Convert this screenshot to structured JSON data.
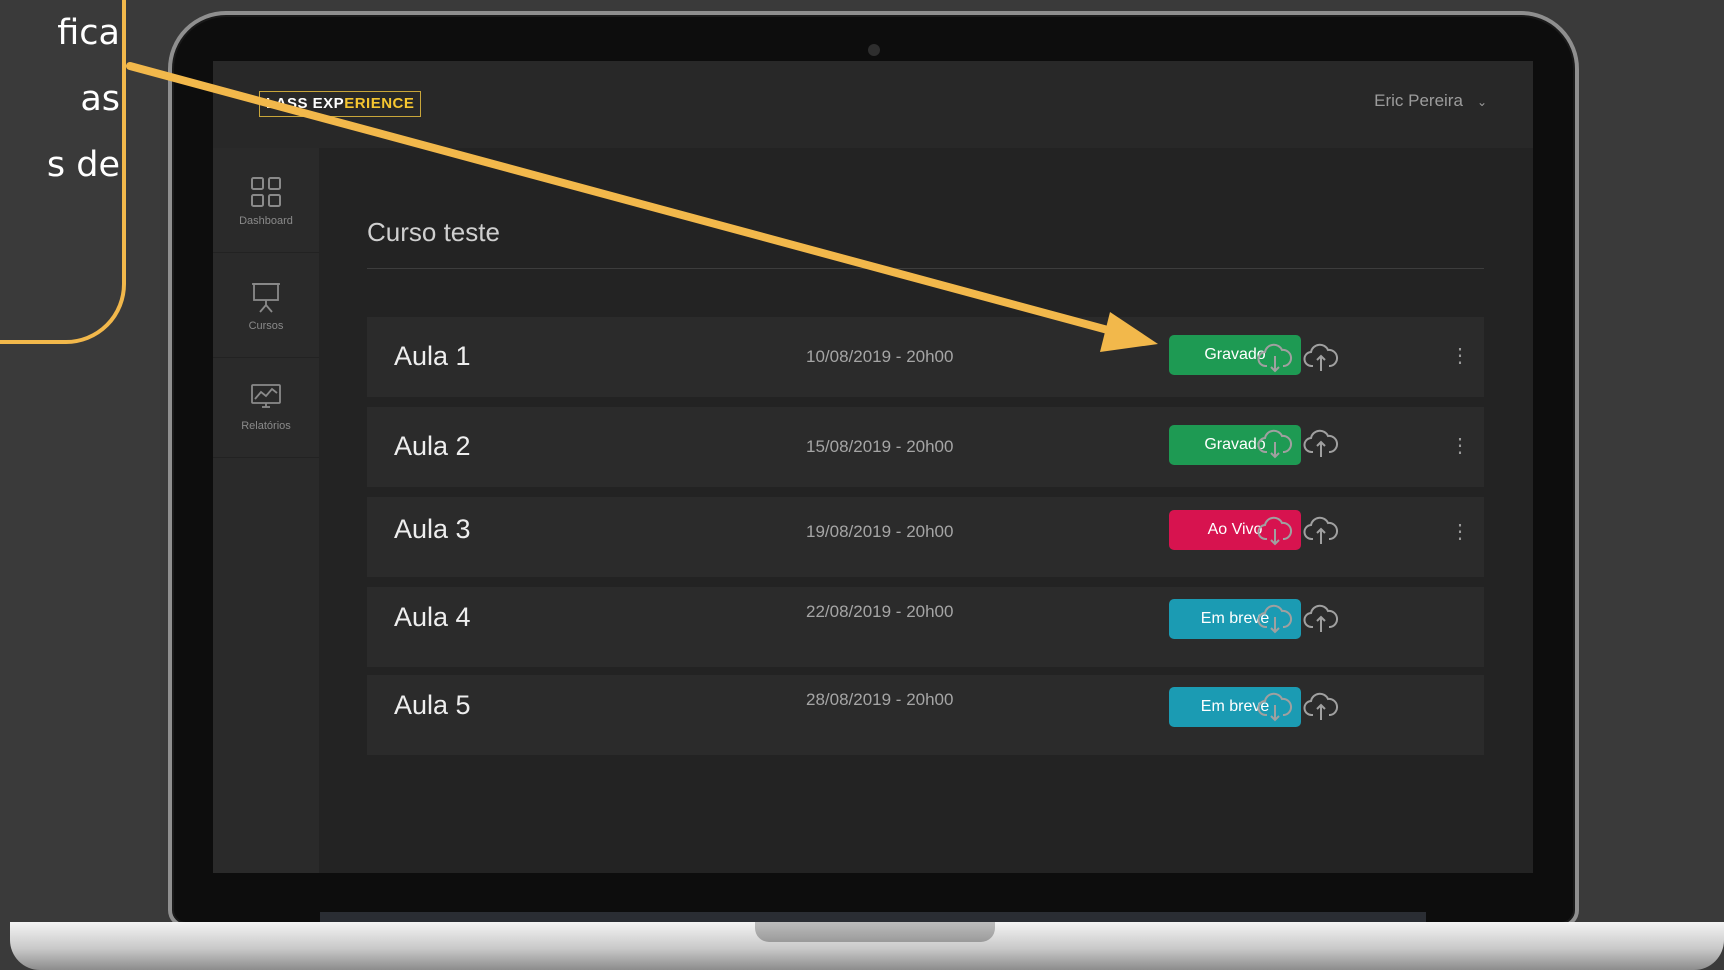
{
  "annotation": {
    "lines": [
      "fica",
      "as",
      "s de"
    ],
    "color": "#f2b84b"
  },
  "app": {
    "logo": {
      "part1": "LASS EXP",
      "part2": "ERIENCE"
    },
    "user": {
      "name": "Eric Pereira",
      "chevron": "⌄"
    }
  },
  "sidebar": {
    "items": [
      {
        "label": "Dashboard",
        "icon": "grid-icon"
      },
      {
        "label": "Cursos",
        "icon": "presentation-board-icon"
      },
      {
        "label": "Relatórios",
        "icon": "chart-monitor-icon"
      }
    ]
  },
  "course": {
    "title": "Curso teste",
    "lessons": [
      {
        "name": "Aula 1",
        "date": "10/08/2019 - 20h00",
        "status": "Gravado",
        "status_color": "#1e9a53",
        "menu": "⋮"
      },
      {
        "name": "Aula 2",
        "date": "15/08/2019 - 20h00",
        "status": "Gravado",
        "status_color": "#1e9a53",
        "menu": "⋮"
      },
      {
        "name": "Aula 3",
        "date": "19/08/2019 - 20h00",
        "status": "Ao Vivo",
        "status_color": "#d7134f",
        "menu": "⋮"
      },
      {
        "name": "Aula 4",
        "date": "22/08/2019 - 20h00",
        "status": "Em breve",
        "status_color": "#1b9bb3"
      },
      {
        "name": "Aula 5",
        "date": "28/08/2019 - 20h00",
        "status": "Em breve",
        "status_color": "#1b9bb3"
      }
    ]
  },
  "icons": {
    "download": "cloud-download-icon",
    "upload": "cloud-upload-icon"
  }
}
